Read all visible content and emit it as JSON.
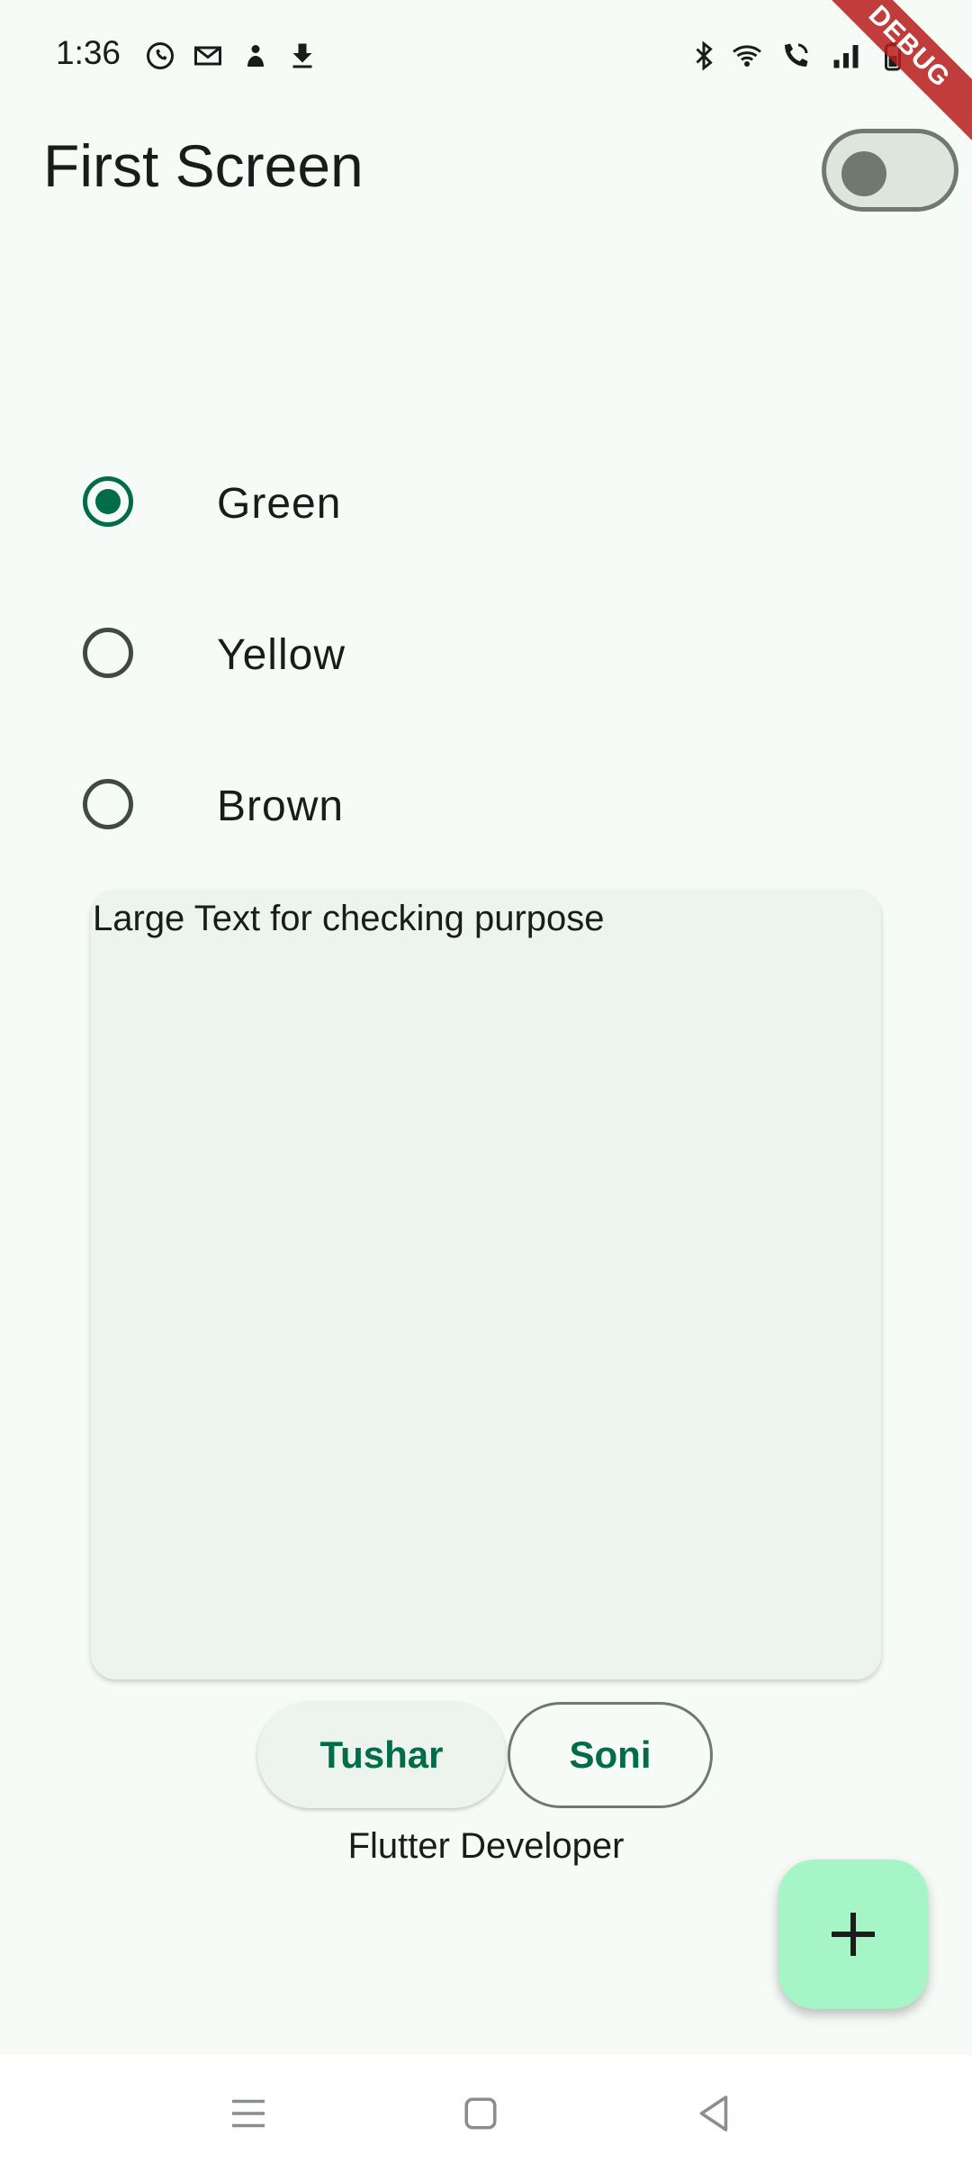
{
  "status_bar": {
    "time": "1:36",
    "left_icons": [
      "whatsapp-icon",
      "gmail-icon",
      "notification-app-icon",
      "download-icon"
    ],
    "right_icons": [
      "bluetooth-icon",
      "wifi-icon",
      "wifi-calling-icon",
      "signal-icon",
      "battery-icon"
    ]
  },
  "debug_banner": "DEBUG",
  "app_bar": {
    "title": "First Screen",
    "theme_switch_on": false
  },
  "radio_group": {
    "selected": "Green",
    "options": [
      "Green",
      "Yellow",
      "Brown"
    ]
  },
  "card": {
    "text": "Large Text for checking purpose"
  },
  "chips": {
    "first": "Tushar",
    "second": "Soni"
  },
  "subtitle": "Flutter Developer",
  "fab": {
    "icon": "plus-icon"
  },
  "nav_bar": {
    "icons": [
      "menu-icon",
      "home-icon",
      "back-icon"
    ]
  },
  "colors": {
    "background": "#f7fbf7",
    "primary": "#006c49",
    "card": "#edf3ed",
    "fab": "#a6f5c6",
    "outline": "#707970"
  }
}
